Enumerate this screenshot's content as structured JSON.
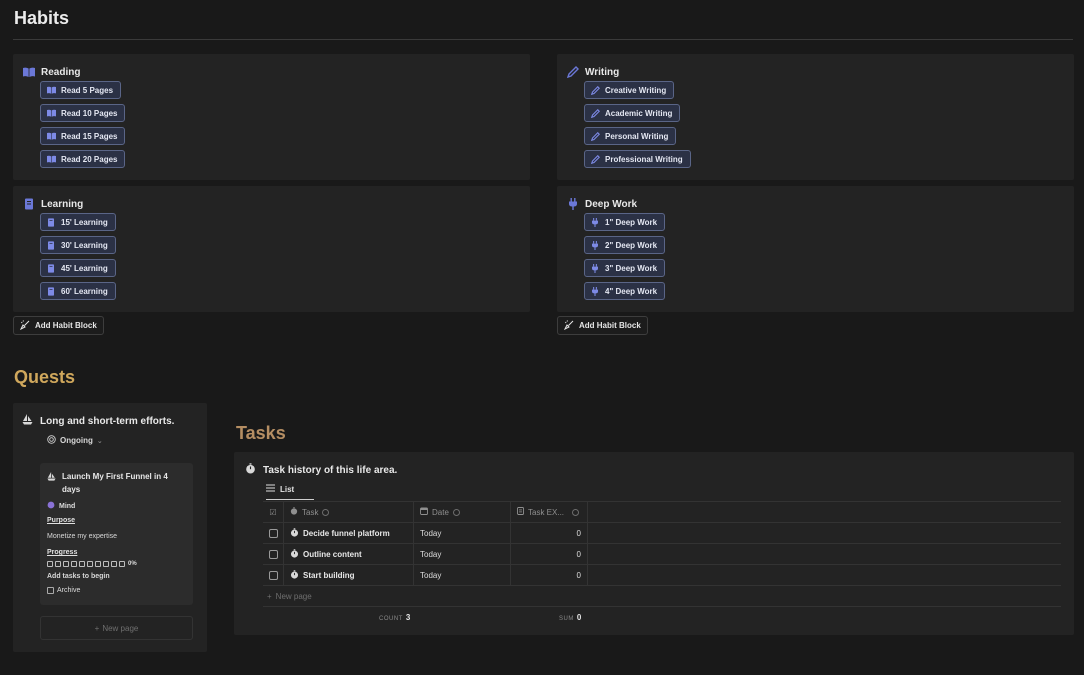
{
  "habits": {
    "title": "Habits",
    "blocks": [
      {
        "title": "Reading",
        "icon": "book-icon",
        "items": [
          "Read 5 Pages",
          "Read 10 Pages",
          "Read 15 Pages",
          "Read 20 Pages"
        ]
      },
      {
        "title": "Writing",
        "icon": "pen-icon",
        "items": [
          "Creative Writing",
          "Academic Writing",
          "Personal Writing",
          "Professional Writing"
        ]
      },
      {
        "title": "Learning",
        "icon": "notebook-icon",
        "items": [
          "15' Learning",
          "30' Learning",
          "45' Learning",
          "60' Learning"
        ]
      },
      {
        "title": "Deep Work",
        "icon": "plug-icon",
        "items": [
          "1\" Deep Work",
          "2\" Deep Work",
          "3\" Deep Work",
          "4\" Deep Work"
        ]
      }
    ],
    "add_button": "Add Habit Block"
  },
  "quests": {
    "title": "Quests",
    "view_title": "Long and short-term efforts.",
    "status": "Ongoing",
    "card": {
      "title": "Launch My First Funnel in 4 days",
      "tag": "Mind",
      "purpose_label": "Purpose",
      "purpose_value": "Monetize my expertise",
      "progress_label": "Progress",
      "progress_percent": "0%",
      "progress_note": "Add tasks to begin",
      "archive_label": "Archive"
    },
    "new_page": "New page"
  },
  "tasks": {
    "title": "Tasks",
    "view_title": "Task history of this life area.",
    "view_name": "List",
    "columns": {
      "task": "Task",
      "date": "Date",
      "exp": "Task EX..."
    },
    "rows": [
      {
        "task": "Decide funnel platform",
        "date": "Today",
        "exp": "0"
      },
      {
        "task": "Outline content",
        "date": "Today",
        "exp": "0"
      },
      {
        "task": "Start building",
        "date": "Today",
        "exp": "0"
      }
    ],
    "new_page": "New page",
    "count_label": "COUNT",
    "count_value": "3",
    "sum_label": "SUM",
    "sum_value": "0"
  },
  "colors": {
    "accent_blue": "#6b78d8",
    "quests_gold": "#cfa75c",
    "tasks_brown": "#b58e63",
    "background": "#191919"
  }
}
